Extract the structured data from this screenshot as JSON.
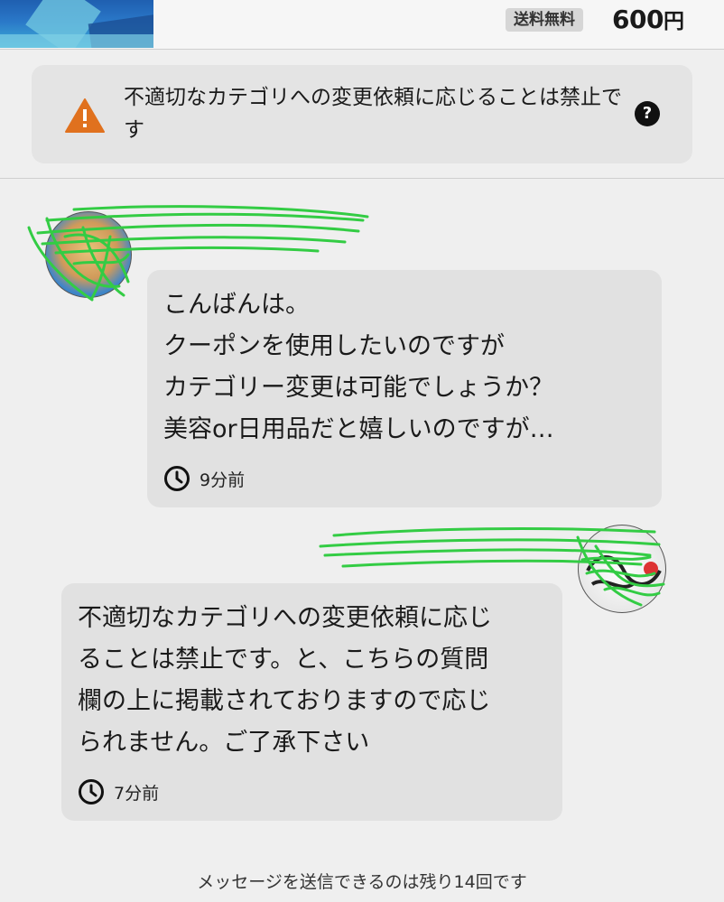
{
  "product": {
    "shipping_badge": "送料無料",
    "price_number": "600",
    "price_unit": "円"
  },
  "warning": {
    "text": "不適切なカテゴリへの変更依頼に応じることは禁止です",
    "icon": "warning-triangle-icon",
    "help_icon": "question-circle-icon",
    "help_glyph": "?",
    "accent": "#e0711e"
  },
  "messages": [
    {
      "text": "こんばんは。\nクーポンを使用したいのですが\nカテゴリー変更は可能でしょうか？\n美容or日用品だと嬉しいのですが…",
      "time": "9分前"
    },
    {
      "text": "不適切なカテゴリへの変更依頼に応じ\nることは禁止です。と、こちらの質問\n欄の上に掲載されておりますので応じ\nられません。ご了承下さい",
      "time": "7分前"
    }
  ],
  "footer": {
    "remaining": "メッセージを送信できるのは残り14回です"
  },
  "colors": {
    "scribble": "#33cc44",
    "bubble": "#e1e1e1",
    "background": "#efefef"
  }
}
